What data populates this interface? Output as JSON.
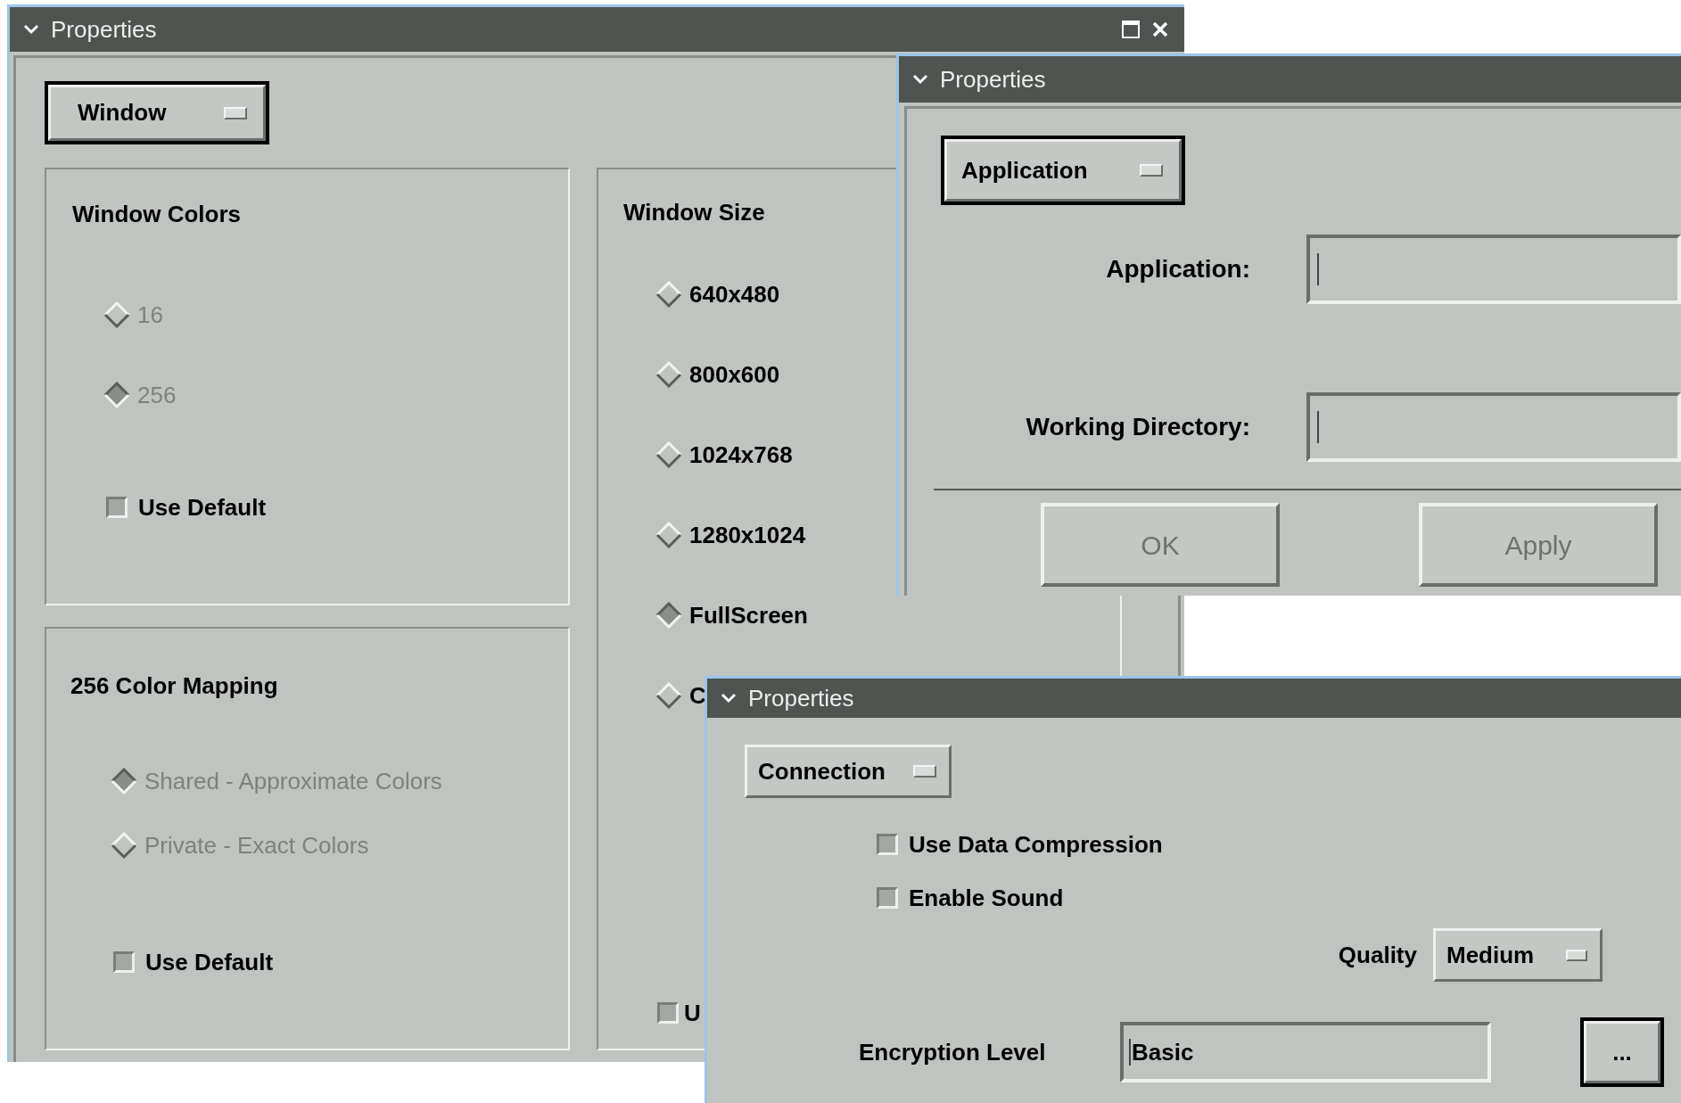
{
  "display_window": {
    "title": "Properties",
    "category_menu": {
      "label": "Window",
      "focused": true
    },
    "window_colors": {
      "title": "Window Colors",
      "options": [
        {
          "label": "16",
          "selected": false,
          "disabled": true
        },
        {
          "label": "256",
          "selected": true,
          "disabled": true
        }
      ],
      "use_default": {
        "label": "Use Default",
        "checked": false
      }
    },
    "color_mapping": {
      "title": "256 Color Mapping",
      "options": [
        {
          "label": "Shared - Approximate Colors",
          "selected": true,
          "disabled": true
        },
        {
          "label": "Private - Exact Colors",
          "selected": false,
          "disabled": true
        }
      ],
      "use_default": {
        "label": "Use Default",
        "checked": false
      }
    },
    "window_size": {
      "title": "Window Size",
      "options": [
        {
          "label": "640x480",
          "selected": false,
          "disabled": false
        },
        {
          "label": "800x600",
          "selected": false,
          "disabled": false
        },
        {
          "label": "1024x768",
          "selected": false,
          "disabled": false
        },
        {
          "label": "1280x1024",
          "selected": false,
          "disabled": false
        },
        {
          "label": "FullScreen",
          "selected": true,
          "disabled": false
        },
        {
          "label": "C",
          "selected": false,
          "disabled": false
        }
      ],
      "checkbox": {
        "label": "U",
        "checked": false
      }
    }
  },
  "application_window": {
    "title": "Properties",
    "category_menu": {
      "label": "Application",
      "focused": true
    },
    "fields": [
      {
        "label": "Application:"
      },
      {
        "label": "Working Directory:"
      }
    ],
    "buttons": [
      {
        "label": "OK",
        "disabled": true
      },
      {
        "label": "Apply",
        "disabled": true
      }
    ]
  },
  "connection_window": {
    "title": "Properties",
    "category_menu": {
      "label": "Connection",
      "focused": false
    },
    "options": [
      {
        "label": "Use Data Compression",
        "checked": false
      },
      {
        "label": "Enable Sound",
        "checked": false
      }
    ],
    "quality": {
      "label": "Quality",
      "value": "Medium"
    },
    "encryption": {
      "label": "Encryption Level",
      "value": "Basic",
      "browse_button": {
        "label": "...",
        "focused": true
      }
    }
  }
}
